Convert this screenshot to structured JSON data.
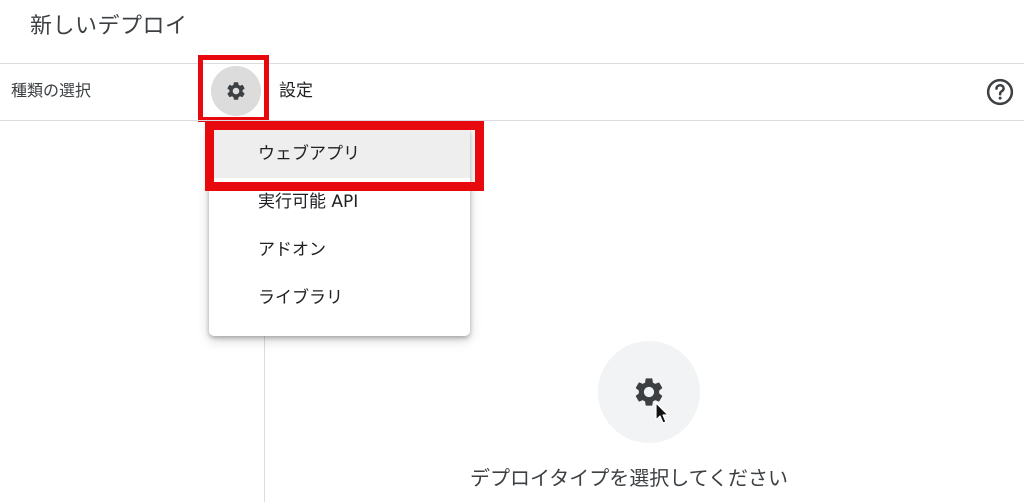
{
  "dialog": {
    "title": "新しいデプロイ"
  },
  "type_selector": {
    "label": "種類の選択",
    "gear_icon": "gear-icon",
    "settings_label": "設定",
    "help_icon": "help-circle-icon"
  },
  "dropdown": {
    "items": [
      {
        "label": "ウェブアプリ"
      },
      {
        "label": "実行可能 API"
      },
      {
        "label": "アドオン"
      },
      {
        "label": "ライブラリ"
      }
    ],
    "selected_label": "ウェブアプリ"
  },
  "empty_state": {
    "icon": "gear-icon",
    "message": "デプロイタイプを選択してください"
  },
  "annotations": {
    "highlight_color": "#e8090f"
  },
  "colors": {
    "divider": "#dadce0",
    "gear_button_bg": "#dcdcdc",
    "empty_circle_bg": "#f1f3f4",
    "selected_item_bg": "#eeeeee"
  }
}
